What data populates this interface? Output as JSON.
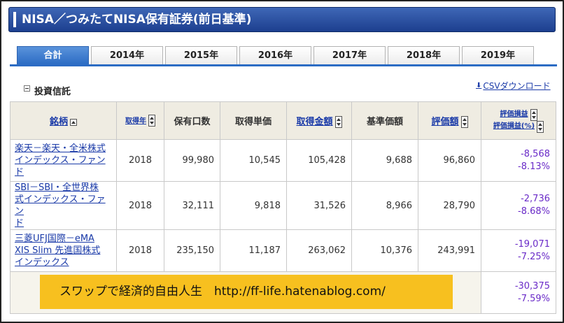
{
  "page_title": "NISA／つみたてNISA保有証券(前日基準)",
  "tabs": [
    {
      "label": "合計",
      "active": true
    },
    {
      "label": "2014年",
      "active": false
    },
    {
      "label": "2015年",
      "active": false
    },
    {
      "label": "2016年",
      "active": false
    },
    {
      "label": "2017年",
      "active": false
    },
    {
      "label": "2018年",
      "active": false
    },
    {
      "label": "2019年",
      "active": false
    }
  ],
  "section_title": "投資信託",
  "csv_link": "CSVダウンロード",
  "columns": {
    "name": "銘柄",
    "year": "取得年",
    "units": "保有口数",
    "unit_price": "取得単価",
    "cost": "取得金額",
    "nav": "基準価額",
    "valuation": "評価額",
    "gain": "評価損益",
    "gain_pct": "評価損益(%)"
  },
  "rows": [
    {
      "name_1": "楽天－楽天・全米株式",
      "name_2": "インデックス・ファンド",
      "year": "2018",
      "units": "99,980",
      "unit_price": "10,545",
      "cost": "105,428",
      "nav": "9,688",
      "valuation": "96,860",
      "gain": "-8,568",
      "gain_pct": "-8.13%"
    },
    {
      "name_1": "SBI－SBI・全世界株",
      "name_2": "式インデックス・ファン",
      "name_3": "ド",
      "year": "2018",
      "units": "32,111",
      "unit_price": "9,818",
      "cost": "31,526",
      "nav": "8,966",
      "valuation": "28,790",
      "gain": "-2,736",
      "gain_pct": "-8.68%"
    },
    {
      "name_1": "三菱UFJ国際－eMA",
      "name_2": "XIS Slim 先進国株式",
      "name_3": "インデックス",
      "year": "2018",
      "units": "235,150",
      "unit_price": "11,187",
      "cost": "263,062",
      "nav": "10,376",
      "valuation": "243,991",
      "gain": "-19,071",
      "gain_pct": "-7.25%"
    }
  ],
  "total": {
    "gain": "-30,375",
    "gain_pct": "-7.59%"
  },
  "banner_text": "スワップで経済的自由人生　http://ff-life.hatenablog.com/",
  "colors": {
    "accent": "#2c6cc4",
    "loss": "#6a2bc8",
    "banner": "#f7c01f"
  }
}
